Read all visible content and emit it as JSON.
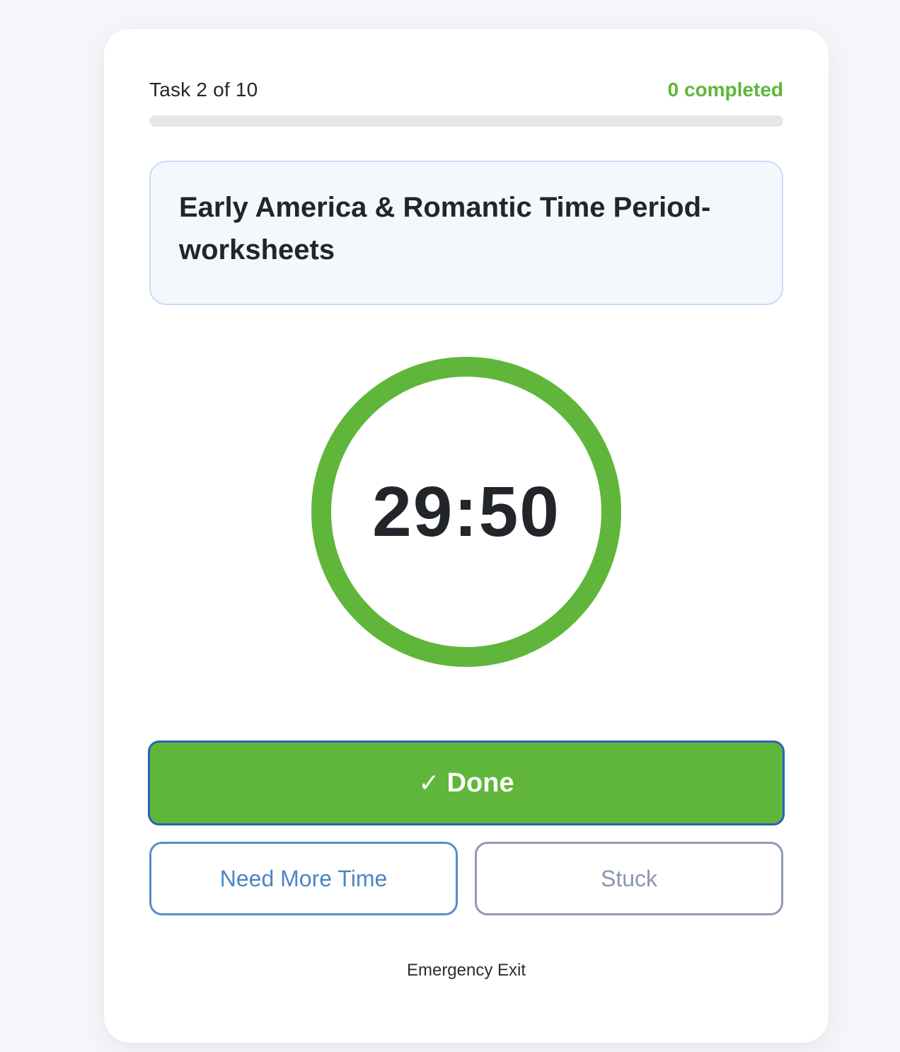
{
  "header": {
    "task_counter": "Task 2 of 10",
    "completed_text": "0 completed"
  },
  "progress": {
    "fraction": 0
  },
  "task": {
    "title": "Early America & Romantic Time Period-worksheets"
  },
  "timer": {
    "display": "29:50",
    "ring_color": "#5fb63a"
  },
  "actions": {
    "done_check": "✓",
    "done_label": "Done",
    "more_time_label": "Need More Time",
    "stuck_label": "Stuck",
    "emergency_exit_label": "Emergency Exit"
  },
  "colors": {
    "accent_green": "#5fb63a",
    "focus_blue": "#2c62b5",
    "link_blue": "#4d85c4",
    "muted_gray": "#8a96ab"
  }
}
